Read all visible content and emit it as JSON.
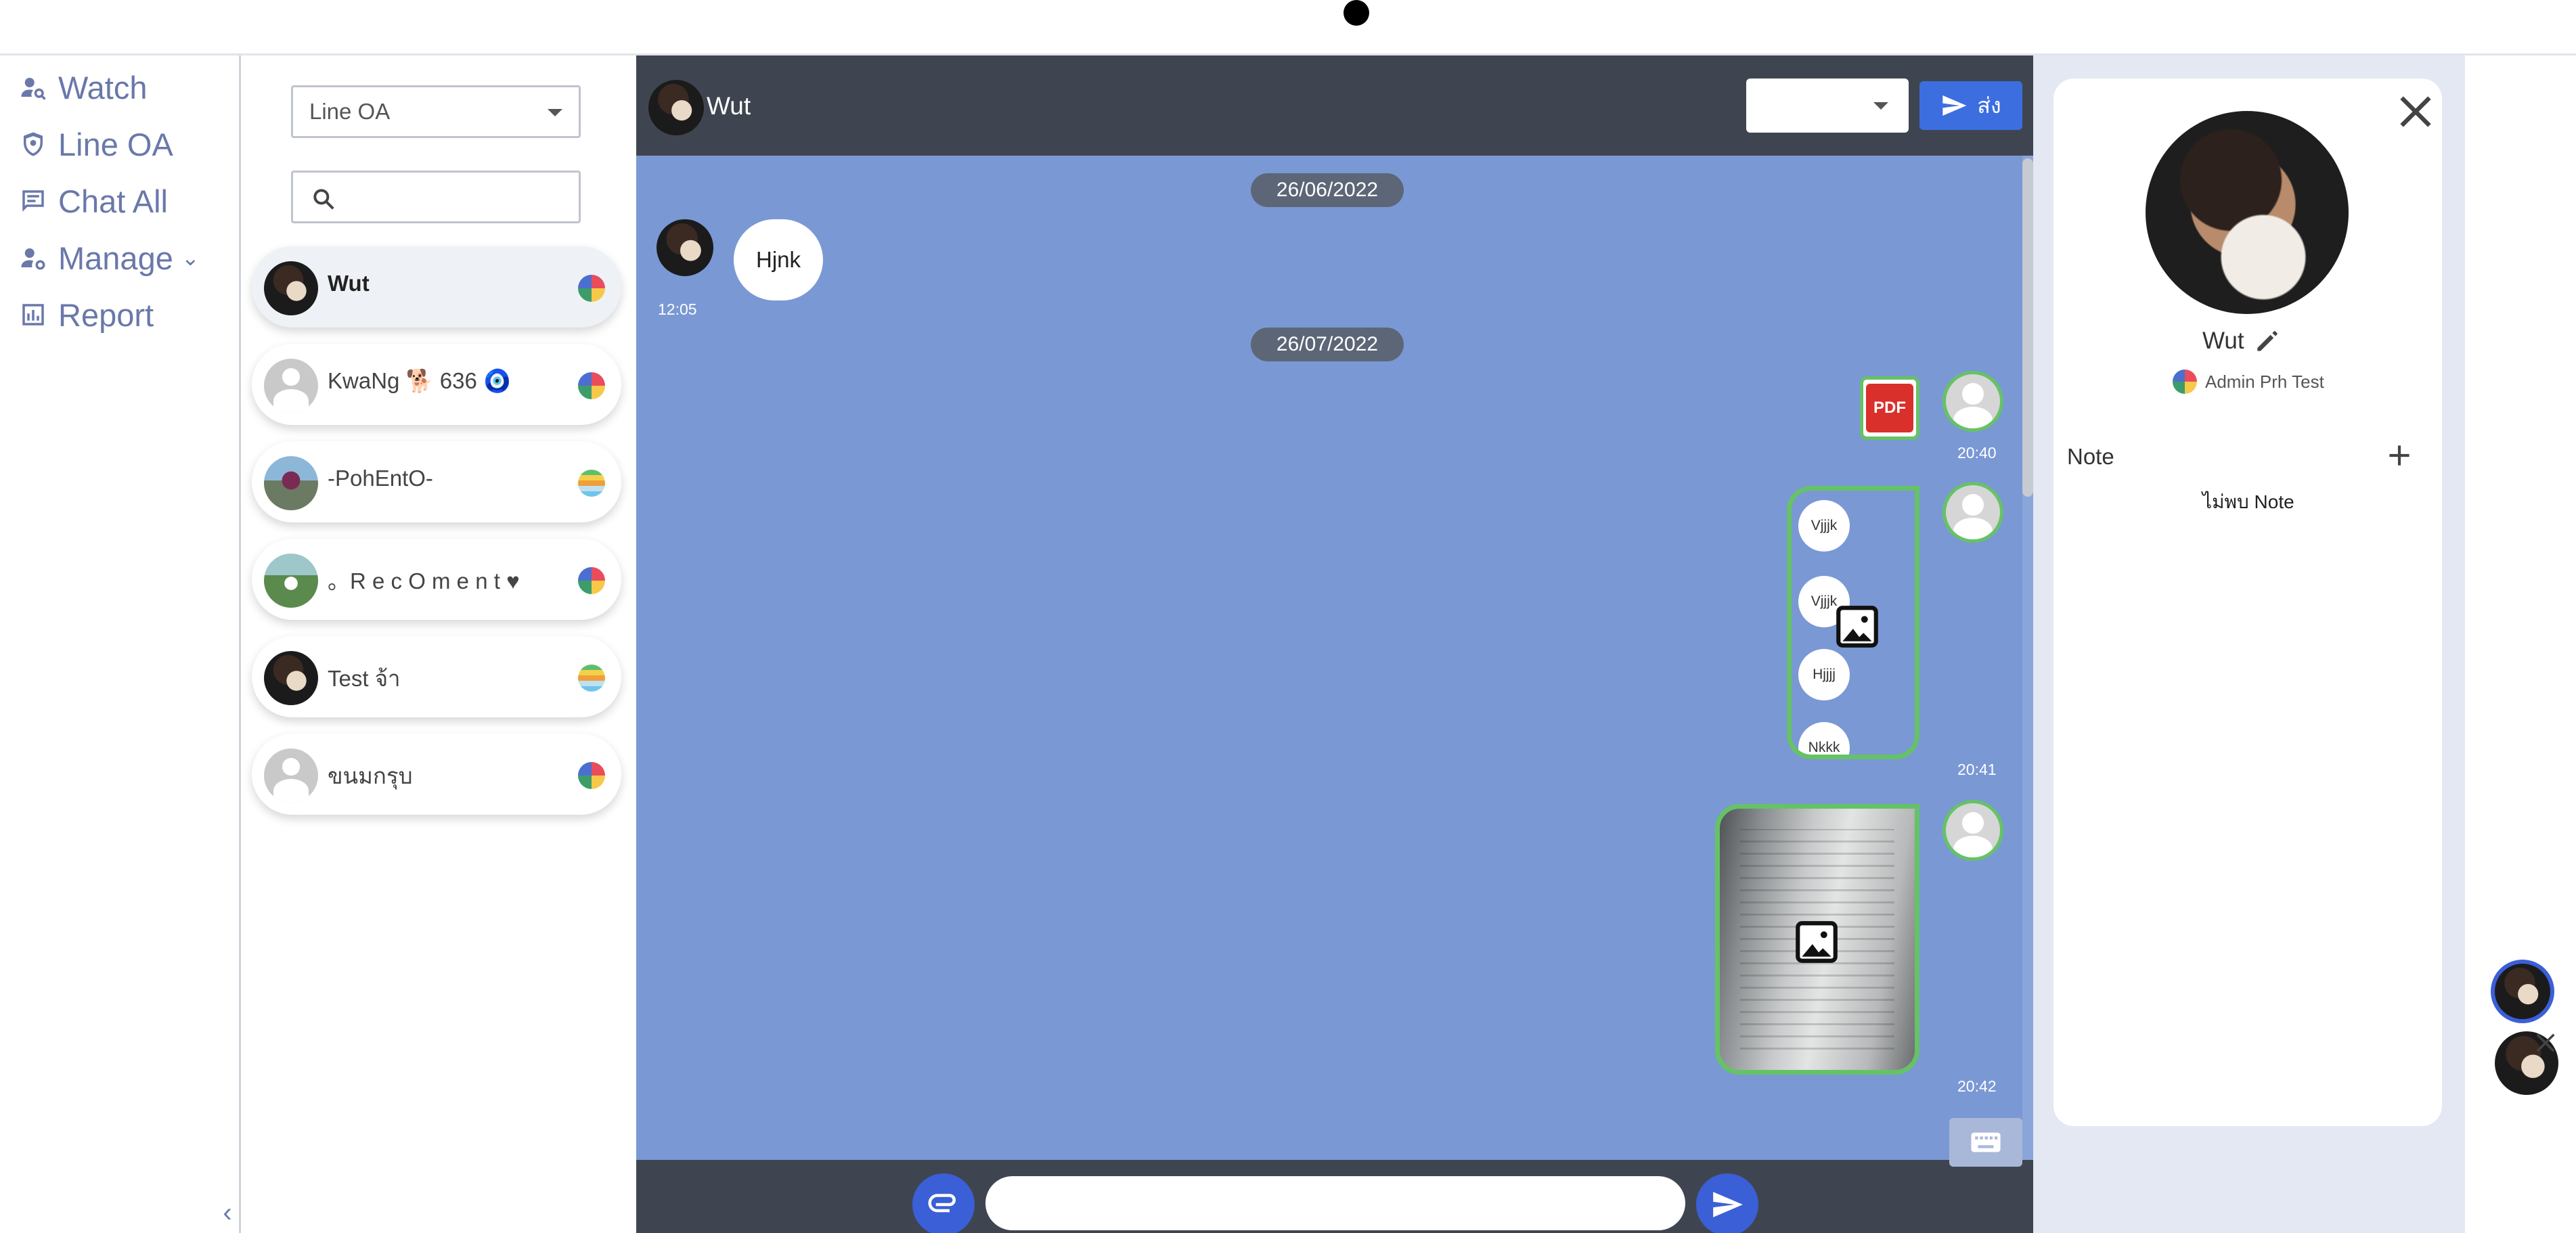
{
  "nav": {
    "items": [
      {
        "label": "Watch",
        "icon": "person-search-icon"
      },
      {
        "label": "Line OA",
        "icon": "shield-icon"
      },
      {
        "label": "Chat All",
        "icon": "chat-list-icon"
      },
      {
        "label": "Manage",
        "icon": "user-gear-icon"
      },
      {
        "label": "Report",
        "icon": "bar-chart-icon"
      }
    ],
    "collapse_glyph": "‹"
  },
  "contacts": {
    "oa_select": "Line OA",
    "search_placeholder": "",
    "list": [
      {
        "name": "Wut",
        "badge": "color",
        "active": true
      },
      {
        "name": "KwaNg 🐕 636 🧿",
        "badge": "color",
        "active": false
      },
      {
        "name": "-PohEntO-",
        "badge": "stripe",
        "active": false
      },
      {
        "name": "。R e c O m e n t ♥",
        "badge": "color",
        "active": false
      },
      {
        "name": "Test จ้า",
        "badge": "stripe",
        "active": false
      },
      {
        "name": "ขนมกรุบ",
        "badge": "color",
        "active": false
      }
    ]
  },
  "chat": {
    "header_name": "Wut",
    "send_label": "ส่ง",
    "dates": [
      "26/06/2022",
      "26/07/2022"
    ],
    "incoming": {
      "text": "Hjnk",
      "time": "12:05"
    },
    "outgoing": [
      {
        "type": "pdf",
        "icon_text": "PDF",
        "time": "20:40"
      },
      {
        "type": "image-stack",
        "bubbles": [
          "Vjjjk",
          "Vjjjk",
          "Hjjjj",
          "Nkkk"
        ],
        "time": "20:41"
      },
      {
        "type": "image-document",
        "time": "20:42"
      }
    ],
    "input_value": ""
  },
  "profile": {
    "name": "Wut",
    "admin": "Admin Prh Test",
    "note_label": "Note",
    "note_empty": "ไม่พบ Note"
  },
  "colors": {
    "nav_text": "#6a78aa",
    "chat_bg": "#7a98d4",
    "header_bg": "#3f4550",
    "accent": "#3b5fd6",
    "bubble_border": "#66c266"
  }
}
